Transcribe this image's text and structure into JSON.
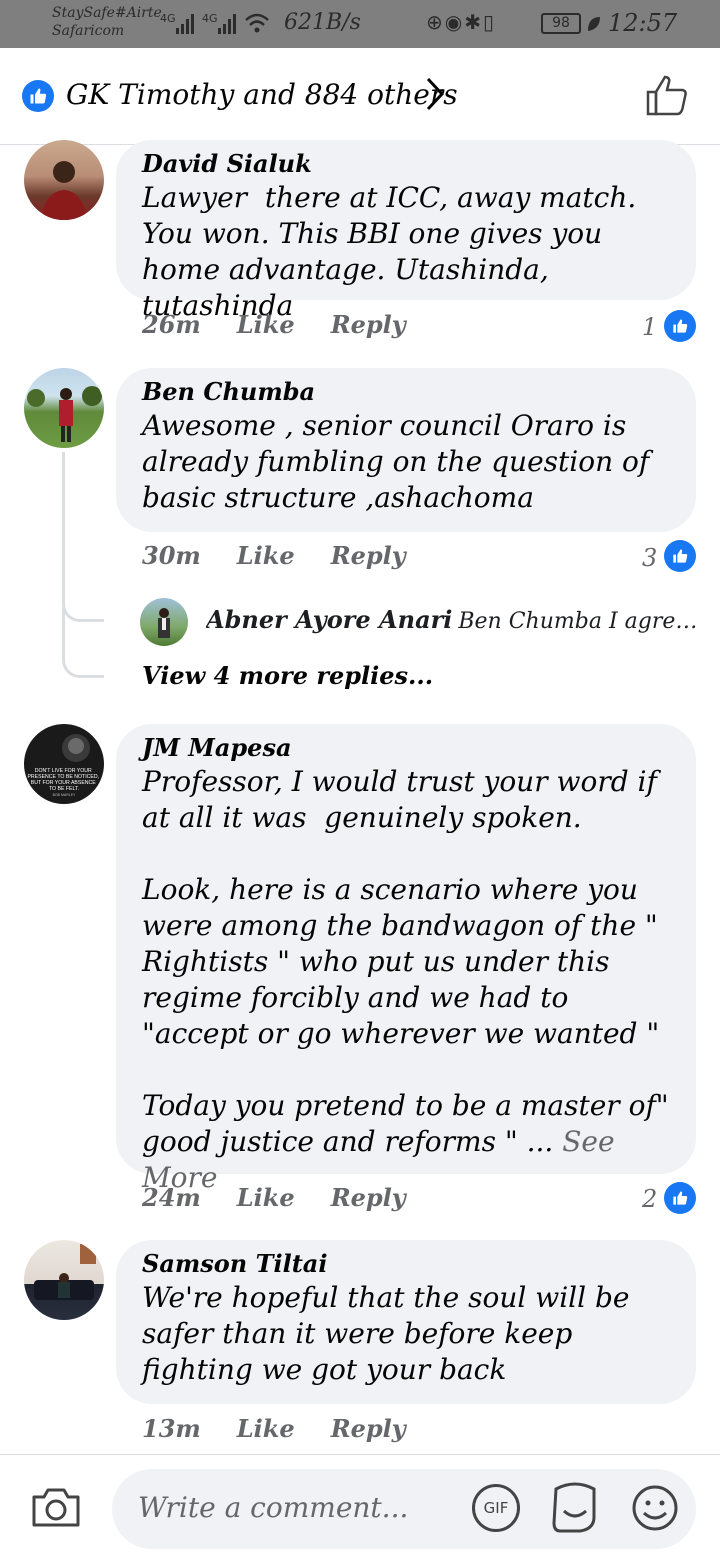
{
  "status_bar": {
    "carrier_1": "StaySafe#Airte",
    "carrier_2": "Safaricom",
    "network_1": "4G",
    "network_2": "4G",
    "speed": "621B/s",
    "battery": "98",
    "time": "12:57"
  },
  "reactions": {
    "text": "GK Timothy and 884 others",
    "icon": "like-icon",
    "accent": "#1877f2"
  },
  "comments": [
    {
      "author": "David Sialuk",
      "text": "Lawyer  there at ICC, away match. You won. This BBI one gives you home advantage. Utashinda, tutashinda",
      "time": "26m",
      "like": "Like",
      "reply": "Reply",
      "likes": "1"
    },
    {
      "author": "Ben Chumba",
      "text": "Awesome , senior council Oraro is already fumbling on the question of basic structure ,ashachoma",
      "time": "30m",
      "like": "Like",
      "reply": "Reply",
      "likes": "3",
      "reply_preview": {
        "author": "Abner Ayore Anari",
        "text": "Ben Chumba I agree with y..."
      },
      "view_more": "View 4 more replies..."
    },
    {
      "author": "JM Mapesa",
      "text": "Professor, I would trust your word if at all it was  genuinely spoken.\n\nLook, here is a scenario where you were among the bandwagon of the \" Rightists \" who put us under this regime forcibly and we had to \"accept or go wherever we wanted \"\n\nToday you pretend to be a master of\" good justice and reforms \" ... ",
      "see_more": "See More",
      "avatar_caption": "DON'T LIVE FOR YOUR PRESENCE TO BE NOTICED, BUT FOR YOUR ABSENCE TO BE FELT.",
      "avatar_credit": "BOB MARLEY",
      "time": "24m",
      "like": "Like",
      "reply": "Reply",
      "likes": "2"
    },
    {
      "author": "Samson Tiltai",
      "text": "We're hopeful that the soul will be safer than it were before keep fighting we got your back",
      "time": "13m",
      "like": "Like",
      "reply": "Reply"
    }
  ],
  "composer": {
    "placeholder": "Write a comment...",
    "gif_label": "GIF"
  }
}
